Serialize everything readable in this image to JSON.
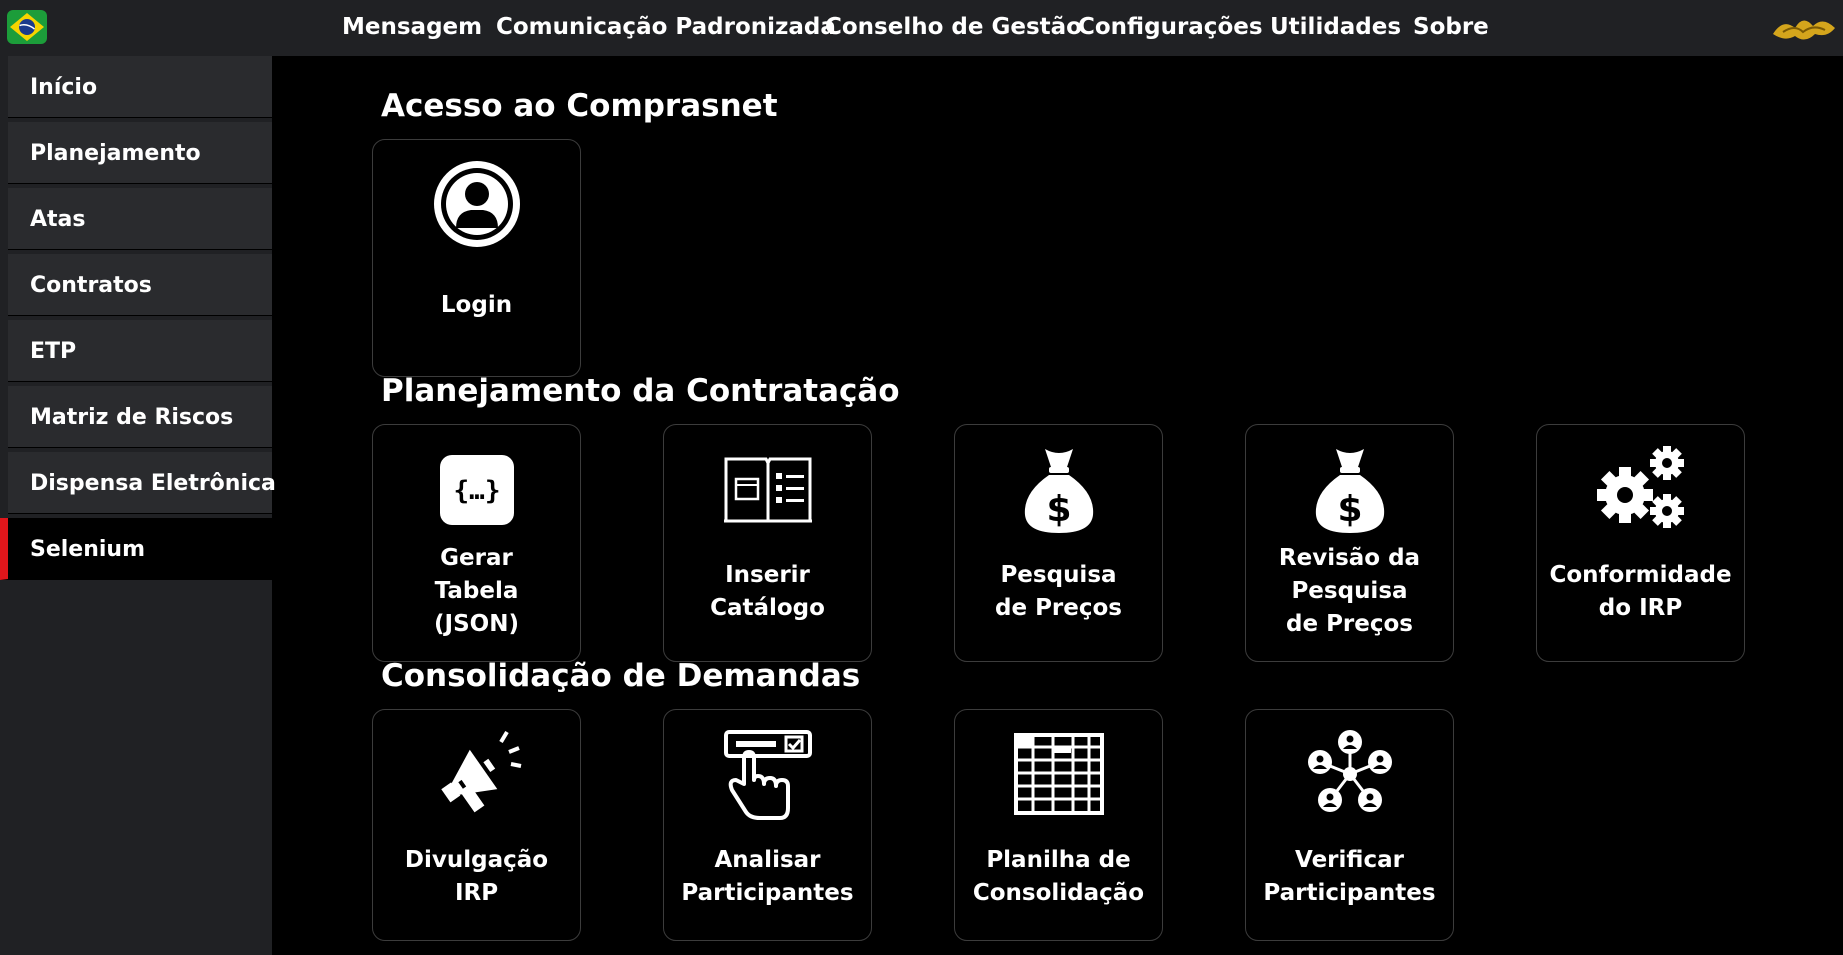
{
  "topbar": {
    "flag_icon": "brazil-flag-icon",
    "crest_icon": "gold-crest-icon",
    "nav": [
      "Mensagem",
      "Comunicação Padronizada",
      "Conselho de Gestão",
      "Configurações",
      "Utilidades",
      "Sobre"
    ]
  },
  "sidebar": {
    "items": [
      "Início",
      "Planejamento",
      "Atas",
      "Contratos",
      "ETP",
      "Matriz de Riscos",
      "Dispensa Eletrônica",
      "Selenium"
    ],
    "active": "Selenium",
    "active_color": "#e0161b"
  },
  "sections": [
    {
      "title": "Acesso ao Comprasnet",
      "cards": [
        {
          "label": "Login",
          "icon": "user-circle-icon"
        }
      ]
    },
    {
      "title": "Planejamento da Contratação",
      "cards": [
        {
          "label": "Gerar\nTabela\n(JSON)",
          "icon": "json-braces-icon"
        },
        {
          "label": "Inserir\nCatálogo",
          "icon": "catalog-book-icon"
        },
        {
          "label": "Pesquisa\nde Preços",
          "icon": "money-bag-icon"
        },
        {
          "label": "Revisão da\nPesquisa\nde Preços",
          "icon": "money-bag-icon"
        },
        {
          "label": "Conformidade\ndo IRP",
          "icon": "gears-icon"
        }
      ]
    },
    {
      "title": "Consolidação de Demandas",
      "cards": [
        {
          "label": "Divulgação\nIRP",
          "icon": "megaphone-icon"
        },
        {
          "label": "Analisar\nParticipantes",
          "icon": "hand-checkbox-icon"
        },
        {
          "label": "Planilha de\nConsolidação",
          "icon": "spreadsheet-icon"
        },
        {
          "label": "Verificar\nParticipantes",
          "icon": "network-people-icon"
        }
      ]
    }
  ]
}
